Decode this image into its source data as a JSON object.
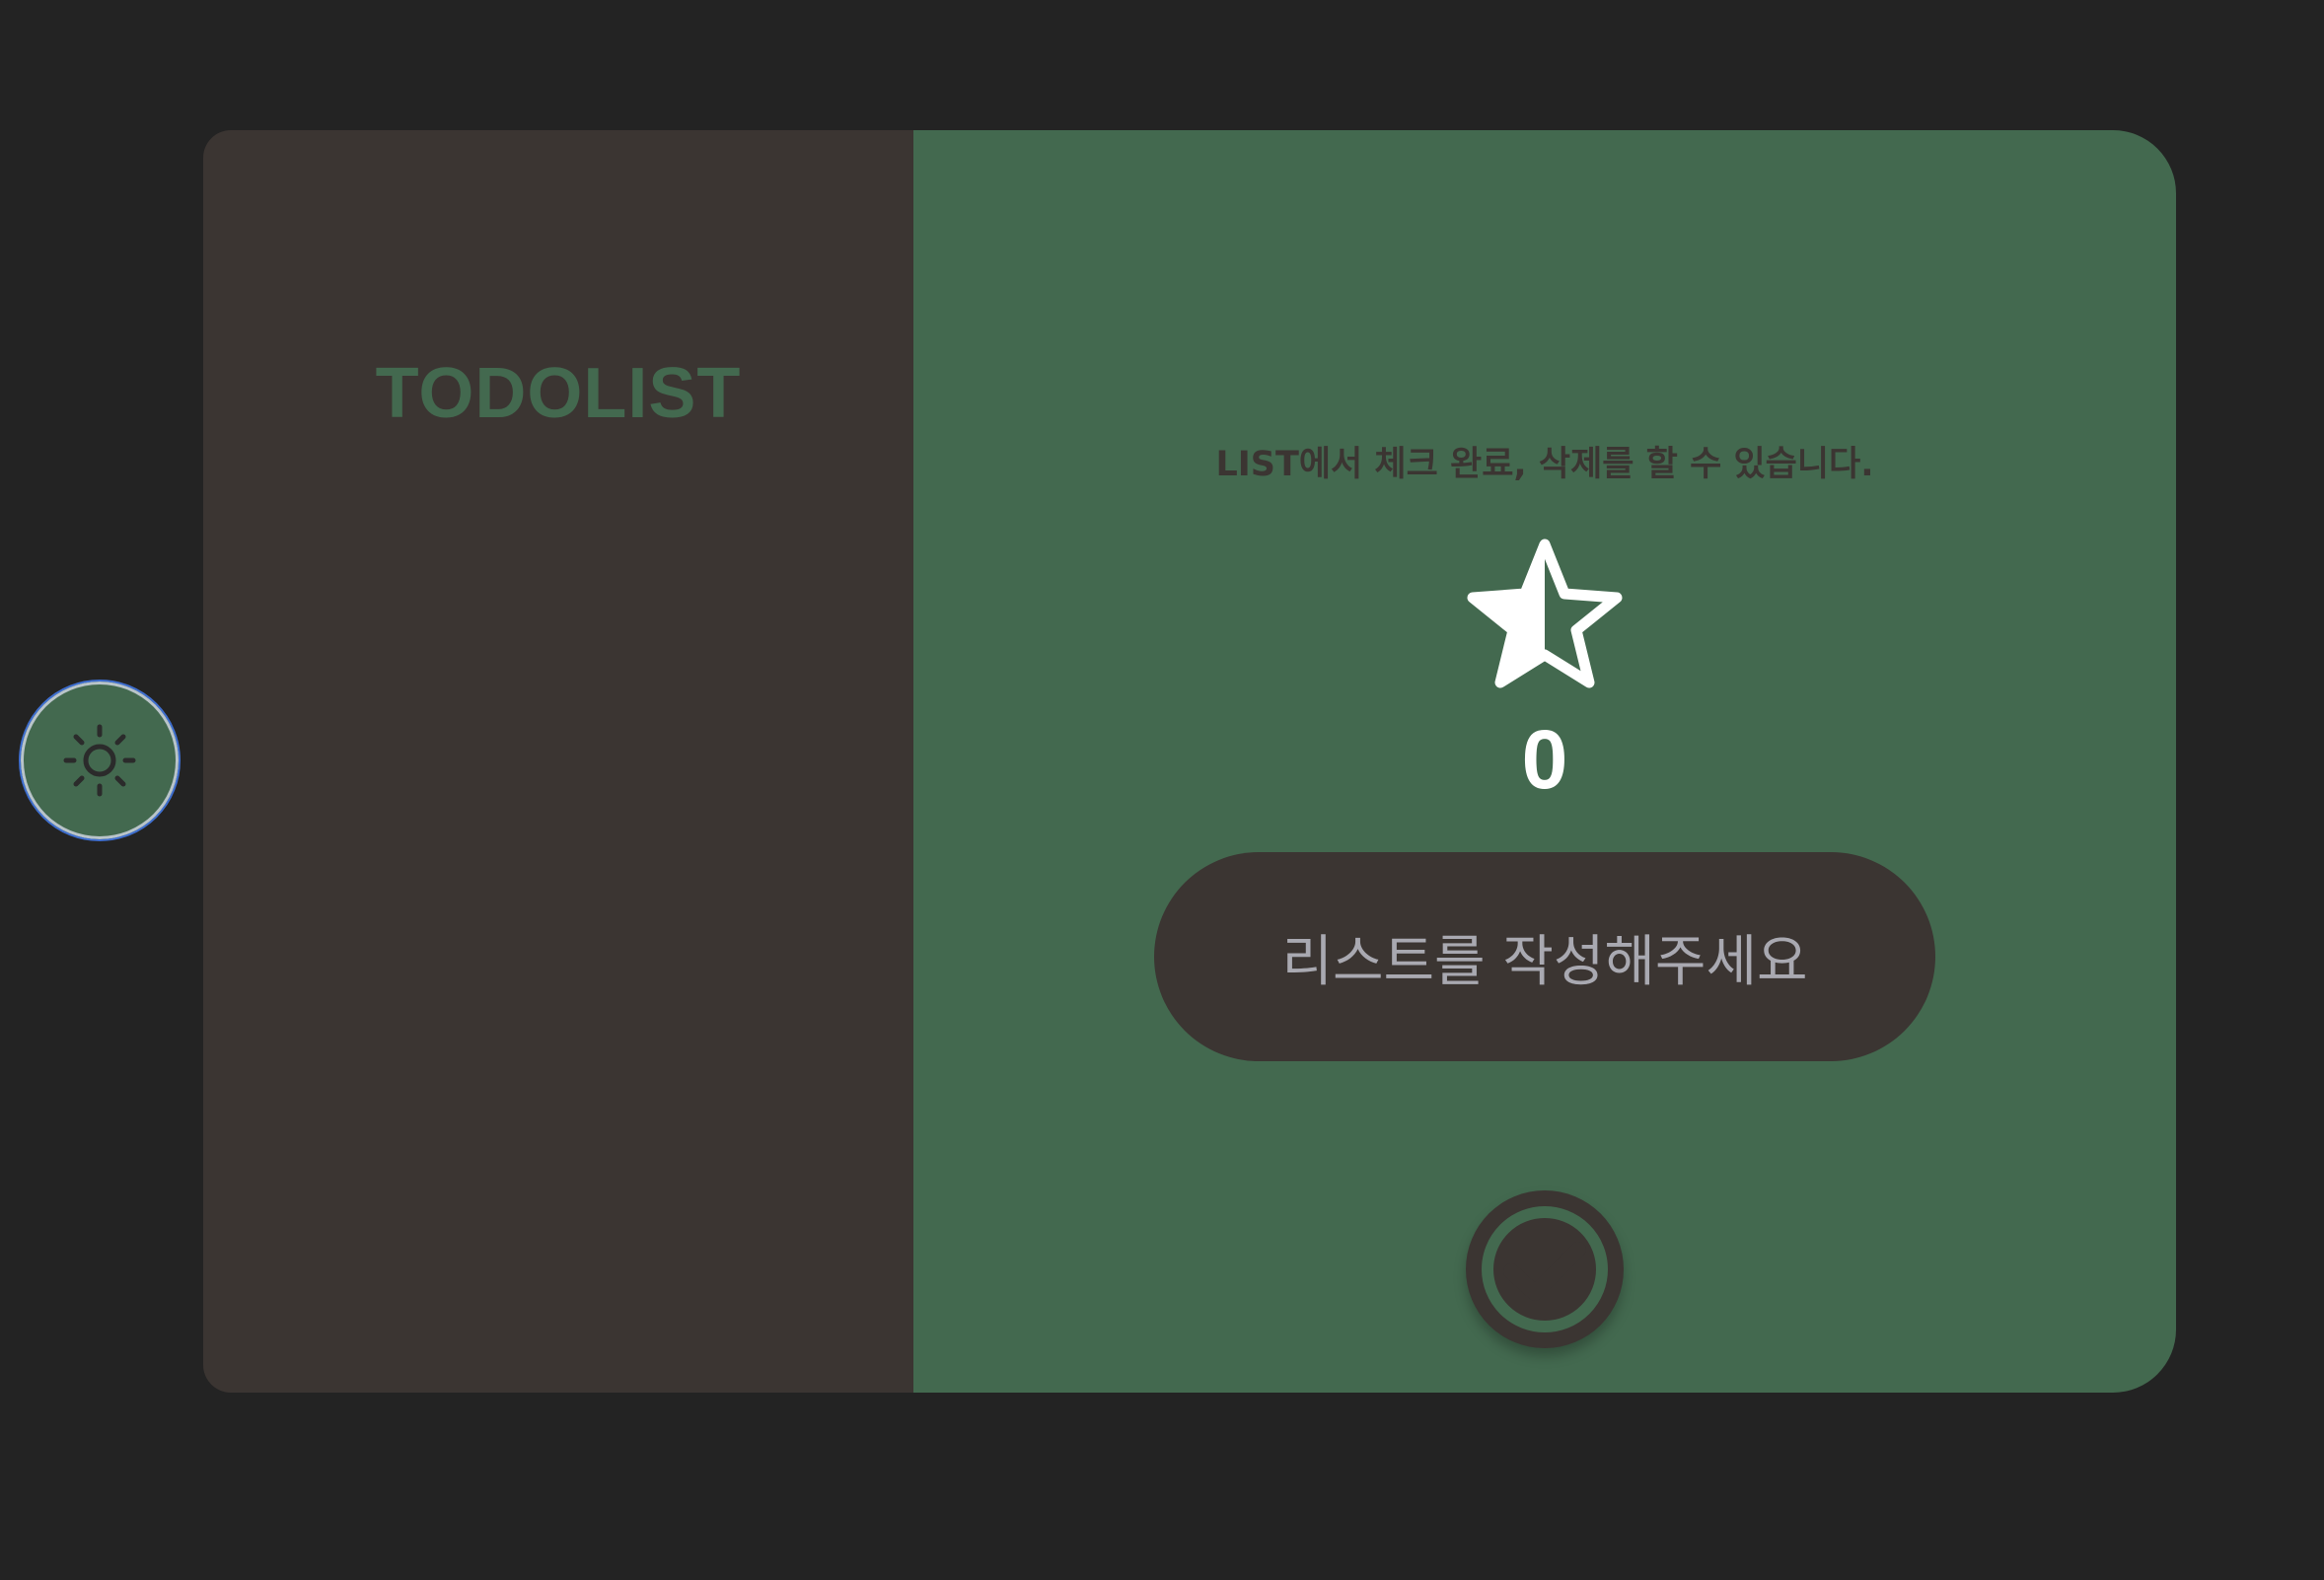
{
  "app": {
    "title": "TODOLIST"
  },
  "main": {
    "hint": "LIST에서 체크 완료, 삭제를 할 수 있습니다.",
    "star_icon": "star-half-icon",
    "count": "0",
    "list_button_label": "리스트를 작성해주세요",
    "check_icon": "check-circle-icon"
  },
  "theme_toggle": {
    "icon": "sun-icon"
  },
  "colors": {
    "background": "#232323",
    "panel_dark": "#3b3532",
    "accent_green": "#43694f",
    "text_muted": "#a9a9b1",
    "white": "#ffffff"
  }
}
